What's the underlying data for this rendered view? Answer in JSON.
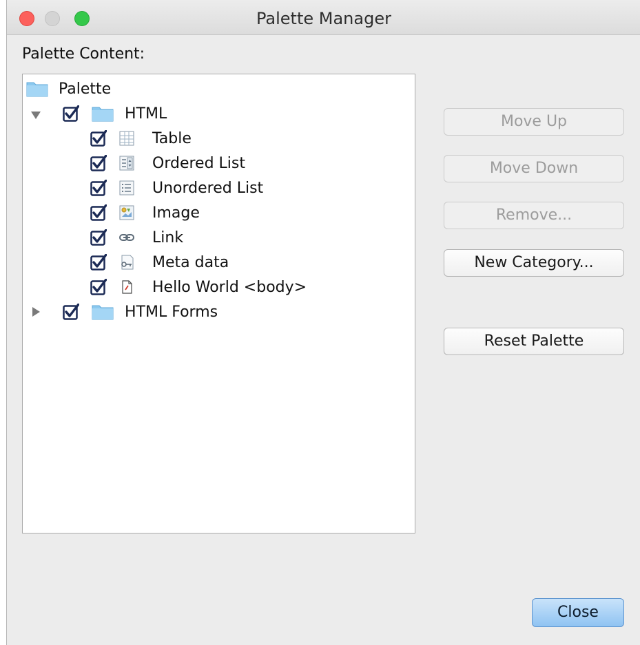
{
  "window": {
    "title": "Palette Manager"
  },
  "content_label": "Palette Content:",
  "tree": {
    "root": {
      "label": "Palette",
      "icon": "folder-icon"
    },
    "categories": [
      {
        "label": "HTML",
        "expanded": true,
        "checked": true,
        "items": [
          {
            "label": "Table",
            "icon": "table-icon",
            "checked": true
          },
          {
            "label": "Ordered List",
            "icon": "ordered-list-icon",
            "checked": true
          },
          {
            "label": "Unordered List",
            "icon": "unordered-list-icon",
            "checked": true
          },
          {
            "label": "Image",
            "icon": "image-icon",
            "checked": true
          },
          {
            "label": "Link",
            "icon": "link-icon",
            "checked": true
          },
          {
            "label": "Meta data",
            "icon": "meta-data-icon",
            "checked": true
          },
          {
            "label": "Hello World <body>",
            "icon": "document-icon",
            "checked": true
          }
        ]
      },
      {
        "label": "HTML Forms",
        "expanded": false,
        "checked": true,
        "items": []
      }
    ]
  },
  "buttons": {
    "move_up": {
      "label": "Move Up",
      "enabled": false
    },
    "move_down": {
      "label": "Move Down",
      "enabled": false
    },
    "remove": {
      "label": "Remove...",
      "enabled": false
    },
    "new_category": {
      "label": "New Category...",
      "enabled": true
    },
    "reset_palette": {
      "label": "Reset Palette",
      "enabled": true
    },
    "close": {
      "label": "Close",
      "enabled": true,
      "default": true
    }
  },
  "colors": {
    "folder": "#8cc9ef",
    "checkbox_border": "#1b2a55",
    "default_button": "#8fc3f2",
    "traffic_close": "#fc605c",
    "traffic_zoom": "#34c84a"
  }
}
